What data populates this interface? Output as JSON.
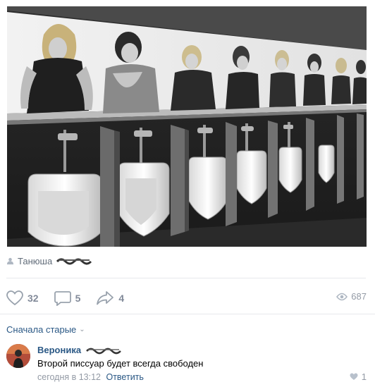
{
  "post": {
    "author_name": "Танюша",
    "image_alt_subject": "urinals-with-women-poster"
  },
  "actions": {
    "likes": "32",
    "comments": "5",
    "shares": "4",
    "views": "687"
  },
  "comments_section": {
    "sort_label": "Сначала старые"
  },
  "comment": {
    "author": "Вероника",
    "text": "Второй писсуар будет всегда свободен",
    "time": "сегодня в 13:12",
    "reply_label": "Ответить",
    "likes": "1"
  },
  "colors": {
    "link": "#2a5885",
    "muted": "#828a99",
    "divider": "#e7e8ec"
  }
}
